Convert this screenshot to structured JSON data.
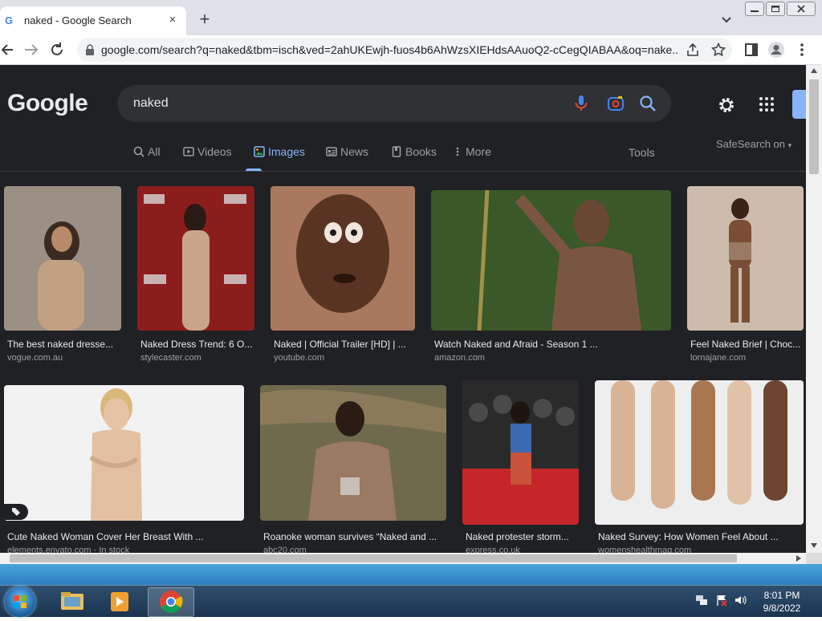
{
  "browser": {
    "tab_title": "naked - Google Search",
    "favicon_letter": "G",
    "new_tab_label": "+",
    "close_label": "×",
    "url": "google.com/search?q=naked&tbm=isch&ved=2ahUKEwjh-fuos4b6AhWzsXIEHdsAAuoQ2-cCegQIABAA&oq=nake..."
  },
  "google": {
    "logo": "Google",
    "query": "naked",
    "tabs": [
      {
        "label": "All",
        "icon": "search-icon"
      },
      {
        "label": "Videos",
        "icon": "play-icon"
      },
      {
        "label": "Images",
        "icon": "image-icon"
      },
      {
        "label": "News",
        "icon": "news-icon"
      },
      {
        "label": "Books",
        "icon": "book-icon"
      },
      {
        "label": "More",
        "icon": "dots-vertical-icon"
      }
    ],
    "tools": "Tools",
    "safesearch": "SafeSearch on"
  },
  "results": [
    {
      "caption": "The best naked dresse...",
      "source": "vogue.com.au",
      "color": "#8a6a55"
    },
    {
      "caption": "Naked Dress Trend: 6 O...",
      "source": "stylecaster.com",
      "color": "#7a2a2a"
    },
    {
      "caption": "Naked | Official Trailer [HD] | ...",
      "source": "youtube.com",
      "color": "#9a6a50"
    },
    {
      "caption": "Watch Naked and Afraid - Season 1 ...",
      "source": "amazon.com",
      "color": "#3f5a2a"
    },
    {
      "caption": "Feel Naked Brief | Choc...",
      "source": "lornajane.com",
      "color": "#c9b7a6"
    },
    {
      "caption": "Cute Naked Woman Cover Her Breast With ...",
      "source": "elements.envato.com · In stock",
      "color": "#ececec"
    },
    {
      "caption": "Roanoke woman survives “Naked and ...",
      "source": "abc20.com",
      "color": "#6a6a55"
    },
    {
      "caption": "Naked protester storm...",
      "source": "express.co.uk",
      "color": "#5a3a3a"
    },
    {
      "caption": "Naked Survey: How Women Feel About ...",
      "source": "womenshealthmag.com",
      "color": "#d8c2b0"
    }
  ],
  "taskbar": {
    "time": "8:01 PM",
    "date": "9/8/2022"
  }
}
